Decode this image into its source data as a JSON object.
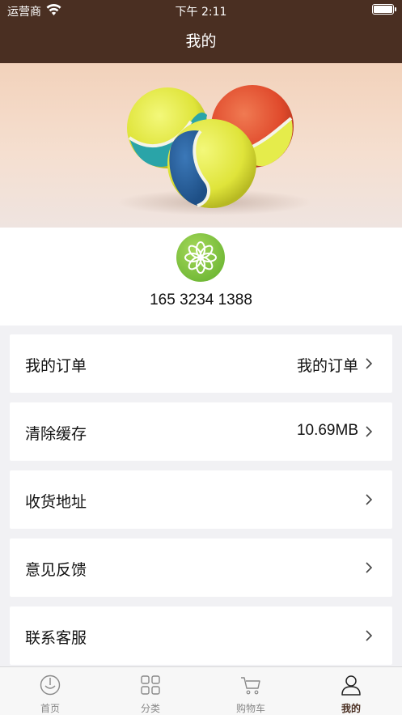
{
  "status_bar": {
    "carrier": "运营商",
    "time": "下午 2:11"
  },
  "nav": {
    "title": "我的"
  },
  "profile": {
    "phone": "165 3234 1388"
  },
  "menu": [
    {
      "label": "我的订单",
      "value": "我的订单"
    },
    {
      "label": "清除缓存",
      "value": "10.69MB"
    },
    {
      "label": "收货地址",
      "value": ""
    },
    {
      "label": "意见反馈",
      "value": ""
    },
    {
      "label": "联系客服",
      "value": ""
    }
  ],
  "tabbar": {
    "items": [
      {
        "label": "首页",
        "icon": "home-icon"
      },
      {
        "label": "分类",
        "icon": "grid-icon"
      },
      {
        "label": "购物车",
        "icon": "cart-icon"
      },
      {
        "label": "我的",
        "icon": "user-icon"
      }
    ],
    "active": "我的"
  },
  "colors": {
    "header": "#4a2f22",
    "background": "#f1f1f4",
    "active_tab": "#4a2f22"
  }
}
